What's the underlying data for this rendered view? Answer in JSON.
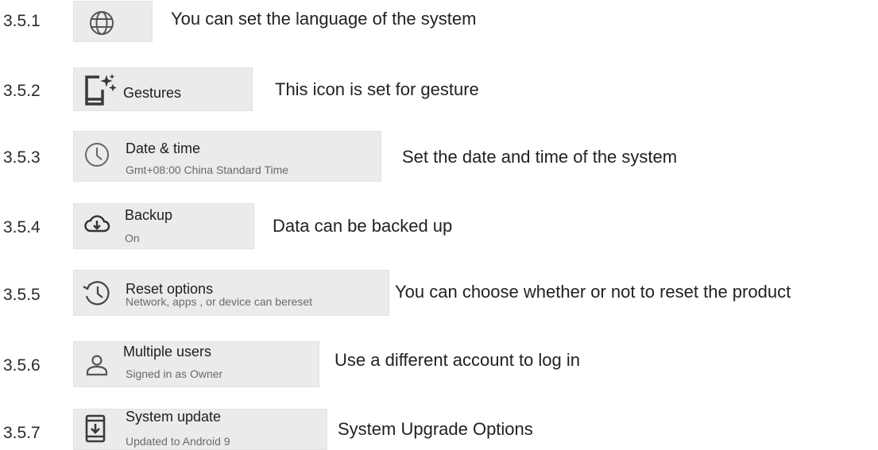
{
  "items": [
    {
      "num": "3.5.1",
      "title": "",
      "subtitle": "",
      "description": "You can set the language of the system",
      "icon": "globe-icon"
    },
    {
      "num": "3.5.2",
      "title": "Gestures",
      "subtitle": "",
      "description": "This icon is set for gesture",
      "icon": "gestures-icon"
    },
    {
      "num": "3.5.3",
      "title": "Date & time",
      "subtitle": "Gmt+08:00 China Standard Time",
      "description": "Set the date and time of the system",
      "icon": "clock-icon"
    },
    {
      "num": "3.5.4",
      "title": "Backup",
      "subtitle": "On",
      "description": "Data can be backed up",
      "icon": "cloud-backup-icon"
    },
    {
      "num": "3.5.5",
      "title": "Reset options",
      "subtitle": "Network, apps , or device can bereset",
      "description": "You can choose whether or not to reset the product",
      "icon": "reset-history-icon"
    },
    {
      "num": "3.5.6",
      "title": "Multiple users",
      "subtitle": "Signed in as Owner",
      "description": "Use a different account to log in",
      "icon": "user-icon"
    },
    {
      "num": "3.5.7",
      "title": "System update",
      "subtitle": "Updated to Android 9",
      "description": "System Upgrade Options",
      "icon": "system-update-icon"
    }
  ]
}
